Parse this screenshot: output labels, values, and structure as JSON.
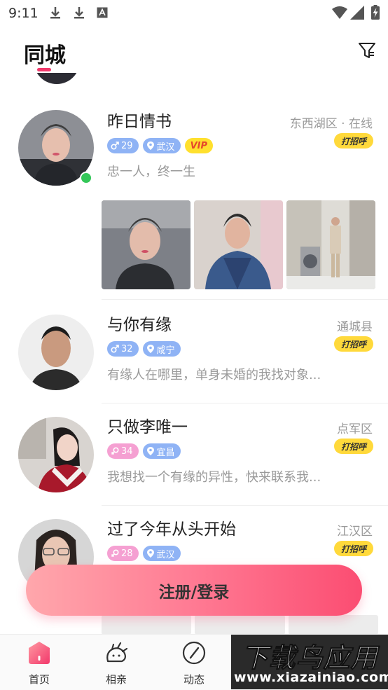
{
  "status_bar": {
    "time": "9:11"
  },
  "header": {
    "title": "同城"
  },
  "users": [
    {
      "name": "昨日情书",
      "gender": "male",
      "age": "29",
      "city": "武汉",
      "vip": "VIP",
      "location": "东西湖区 · 在线",
      "bio": "忠一人，终一生",
      "online": true,
      "hello": "打招呼"
    },
    {
      "name": "与你有缘",
      "gender": "male",
      "age": "32",
      "city": "咸宁",
      "location": "通城县",
      "bio": "有缘人在哪里，单身未婚的我找对象...",
      "hello": "打招呼"
    },
    {
      "name": "只做李唯一",
      "gender": "female",
      "age": "34",
      "city": "宜昌",
      "location": "点军区",
      "bio": "我想找一个有缘的异性，快来联系我...",
      "hello": "打招呼"
    },
    {
      "name": "过了今年从头开始",
      "gender": "female",
      "age": "28",
      "city": "武汉",
      "location": "江汉区",
      "bio": "",
      "hello": "打招呼"
    }
  ],
  "register_button": "注册/登录",
  "nav": {
    "items": [
      {
        "label": "首页",
        "icon": "home-icon"
      },
      {
        "label": "相亲",
        "icon": "dating-icon"
      },
      {
        "label": "动态",
        "icon": "compass-icon"
      }
    ]
  },
  "watermark": {
    "title": "下载鸟应用",
    "url": "www.xiazainiao.com"
  },
  "colors": {
    "accent": "#f2386b",
    "hello_button": "#ffd93b",
    "vip_badge": "#ffe02e",
    "tag_male": "#8fb3f5",
    "tag_female": "#f5a0d2",
    "online": "#34c759"
  }
}
